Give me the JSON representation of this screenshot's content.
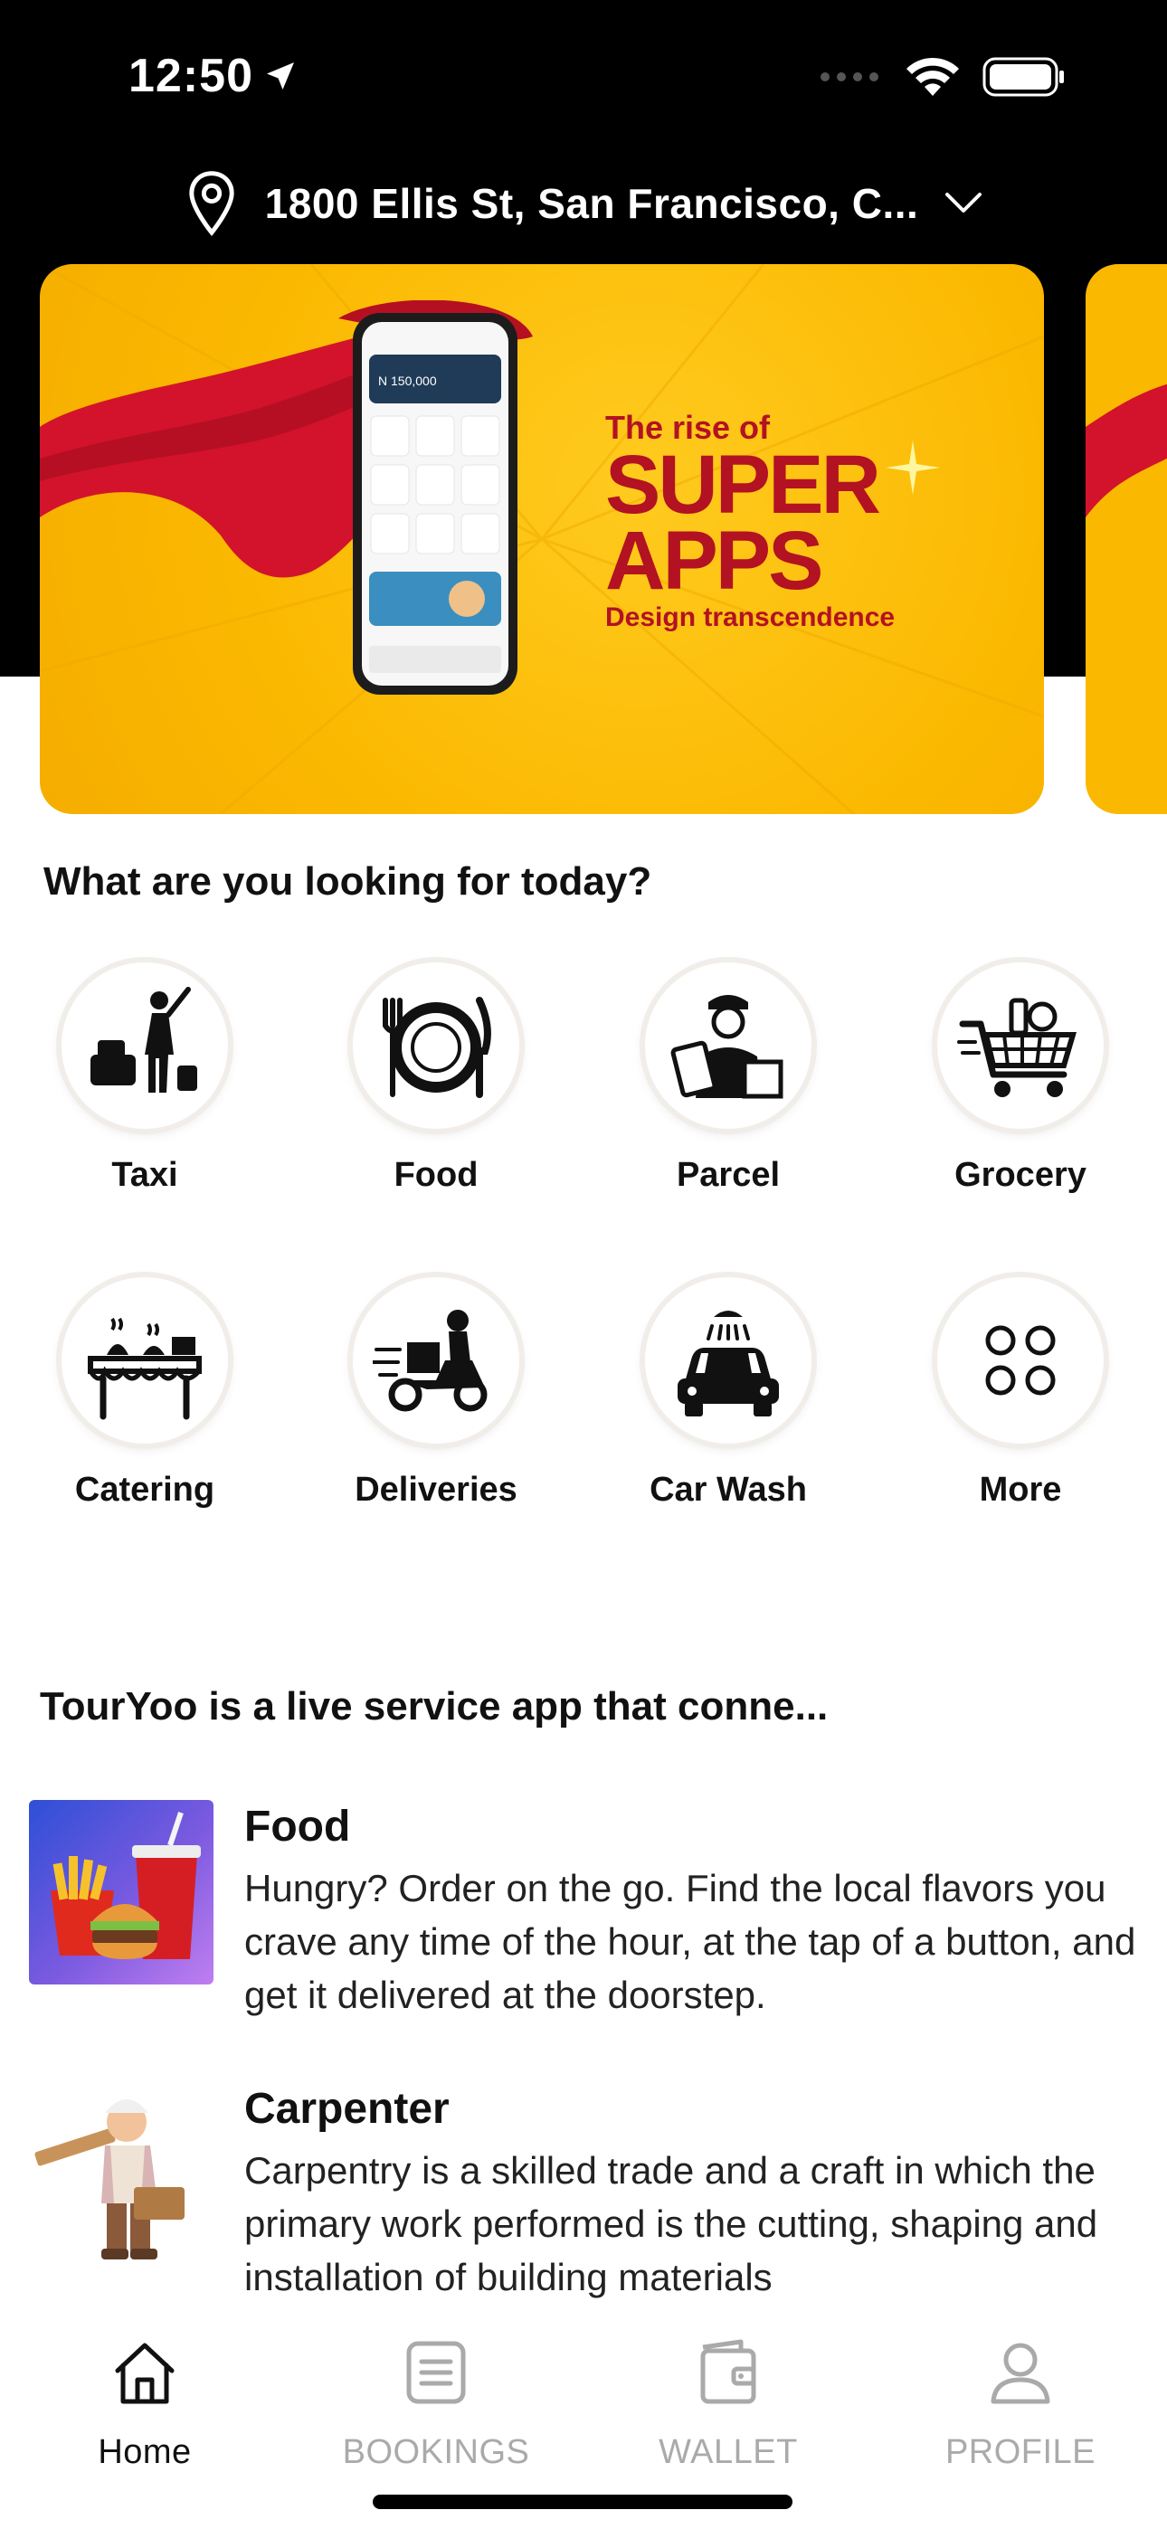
{
  "status_bar": {
    "time": "12:50"
  },
  "address": {
    "text": "1800 Ellis St,  San Francisco,  C..."
  },
  "banner": {
    "kicker": "The rise of",
    "title_line1": "SUPER",
    "title_line2": "APPS",
    "subtitle": "Design transcendence",
    "phone_balance": "N 150,000"
  },
  "categories": {
    "title": "What are you looking for today?",
    "items": [
      {
        "label": "Taxi",
        "icon": "taxi-icon"
      },
      {
        "label": "Food",
        "icon": "food-icon"
      },
      {
        "label": "Parcel",
        "icon": "parcel-icon"
      },
      {
        "label": "Grocery",
        "icon": "grocery-icon"
      },
      {
        "label": "Catering",
        "icon": "catering-icon"
      },
      {
        "label": "Deliveries",
        "icon": "deliveries-icon"
      },
      {
        "label": "Car Wash",
        "icon": "car-wash-icon"
      },
      {
        "label": "More",
        "icon": "more-icon"
      }
    ]
  },
  "about": {
    "title": "TourYoo is a live service  app that conne...",
    "services": [
      {
        "name": "Food",
        "description": "Hungry? Order on the go.  Find the local flavors you crave any time of the hour, at the tap of a button, and get it delivered at the doorstep."
      },
      {
        "name": "Carpenter",
        "description": "Carpentry is a skilled trade and a craft in which the primary work performed is the cutting, shaping and installation of building materials"
      }
    ]
  },
  "tabs": [
    {
      "label": "Home",
      "icon": "home-icon",
      "active": true
    },
    {
      "label": "BOOKINGS",
      "icon": "bookings-icon",
      "active": false
    },
    {
      "label": "WALLET",
      "icon": "wallet-icon",
      "active": false
    },
    {
      "label": "PROFILE",
      "icon": "profile-icon",
      "active": false
    }
  ],
  "colors": {
    "banner": "#fbb800",
    "banner_text": "#b31222",
    "active_tab": "#111111",
    "inactive_tab": "#aaaaaa"
  }
}
